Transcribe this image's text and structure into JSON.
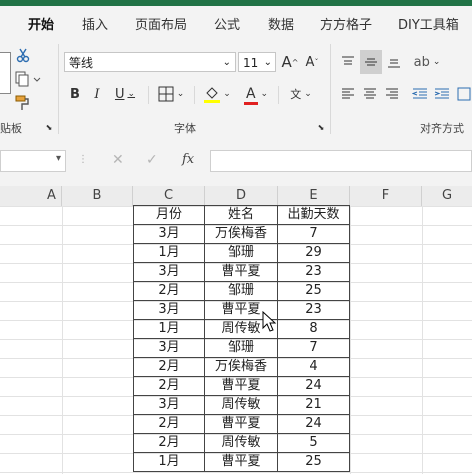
{
  "ribbon_tabs": [
    "开始",
    "插入",
    "页面布局",
    "公式",
    "数据",
    "方方格子",
    "DIY工具箱"
  ],
  "font": {
    "name": "等线",
    "size": "11"
  },
  "groups": {
    "clipboard": "贴板",
    "font": "字体",
    "align": "对齐方式"
  },
  "fx_label": "fx",
  "columns": [
    "A",
    "B",
    "C",
    "D",
    "E",
    "F",
    "G"
  ],
  "table": {
    "headers": [
      "月份",
      "姓名",
      "出勤天数"
    ],
    "rows": [
      [
        "3月",
        "万俟梅香",
        "7"
      ],
      [
        "1月",
        "邹珊",
        "29"
      ],
      [
        "3月",
        "曹平夏",
        "23"
      ],
      [
        "2月",
        "邹珊",
        "25"
      ],
      [
        "3月",
        "曹平夏",
        "23"
      ],
      [
        "1月",
        "周传敏",
        "8"
      ],
      [
        "3月",
        "邹珊",
        "7"
      ],
      [
        "2月",
        "万俟梅香",
        "4"
      ],
      [
        "2月",
        "曹平夏",
        "24"
      ],
      [
        "3月",
        "周传敏",
        "21"
      ],
      [
        "2月",
        "曹平夏",
        "24"
      ],
      [
        "2月",
        "周传敏",
        "5"
      ],
      [
        "1月",
        "曹平夏",
        "25"
      ]
    ]
  },
  "colors": {
    "accent": "#217346"
  }
}
